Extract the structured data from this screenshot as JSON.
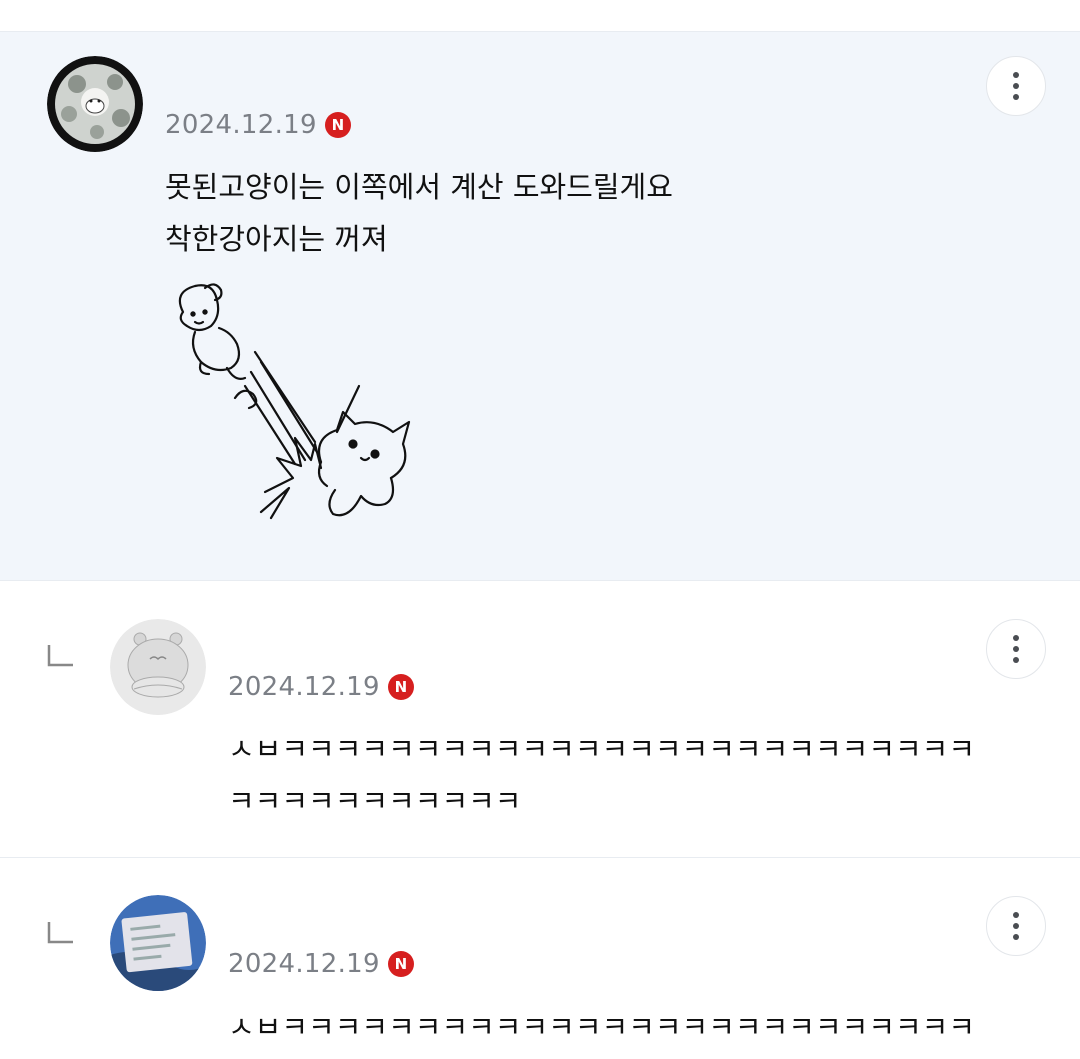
{
  "comments": [
    {
      "date": "2024.12.19",
      "badge": "N",
      "lines": [
        "못된고양이는 이쪽에서 계산 도와드릴게요",
        "착한강아지는 꺼져"
      ],
      "has_sticker": true,
      "more_icon": "kebab-icon"
    },
    {
      "date": "2024.12.19",
      "badge": "N",
      "lines": [
        "ㅅㅂㅋㅋㅋㅋㅋㅋㅋㅋㅋㅋㅋㅋㅋㅋㅋㅋㅋㅋㅋㅋㅋㅋㅋㅋㅋㅋ",
        "ㅋㅋㅋㅋㅋㅋㅋㅋㅋㅋㅋ"
      ],
      "is_reply": true,
      "more_icon": "kebab-icon"
    },
    {
      "date": "2024.12.19",
      "badge": "N",
      "lines": [
        "ㅅㅂㅋㅋㅋㅋㅋㅋㅋㅋㅋㅋㅋㅋㅋㅋㅋㅋㅋㅋㅋㅋㅋㅋㅋㅋㅋㅋ"
      ],
      "is_reply": true,
      "more_icon": "kebab-icon"
    }
  ],
  "colors": {
    "highlight_bg": "#f2f6fb",
    "date_text": "#7b7f86",
    "badge_red": "#d61f1f"
  }
}
